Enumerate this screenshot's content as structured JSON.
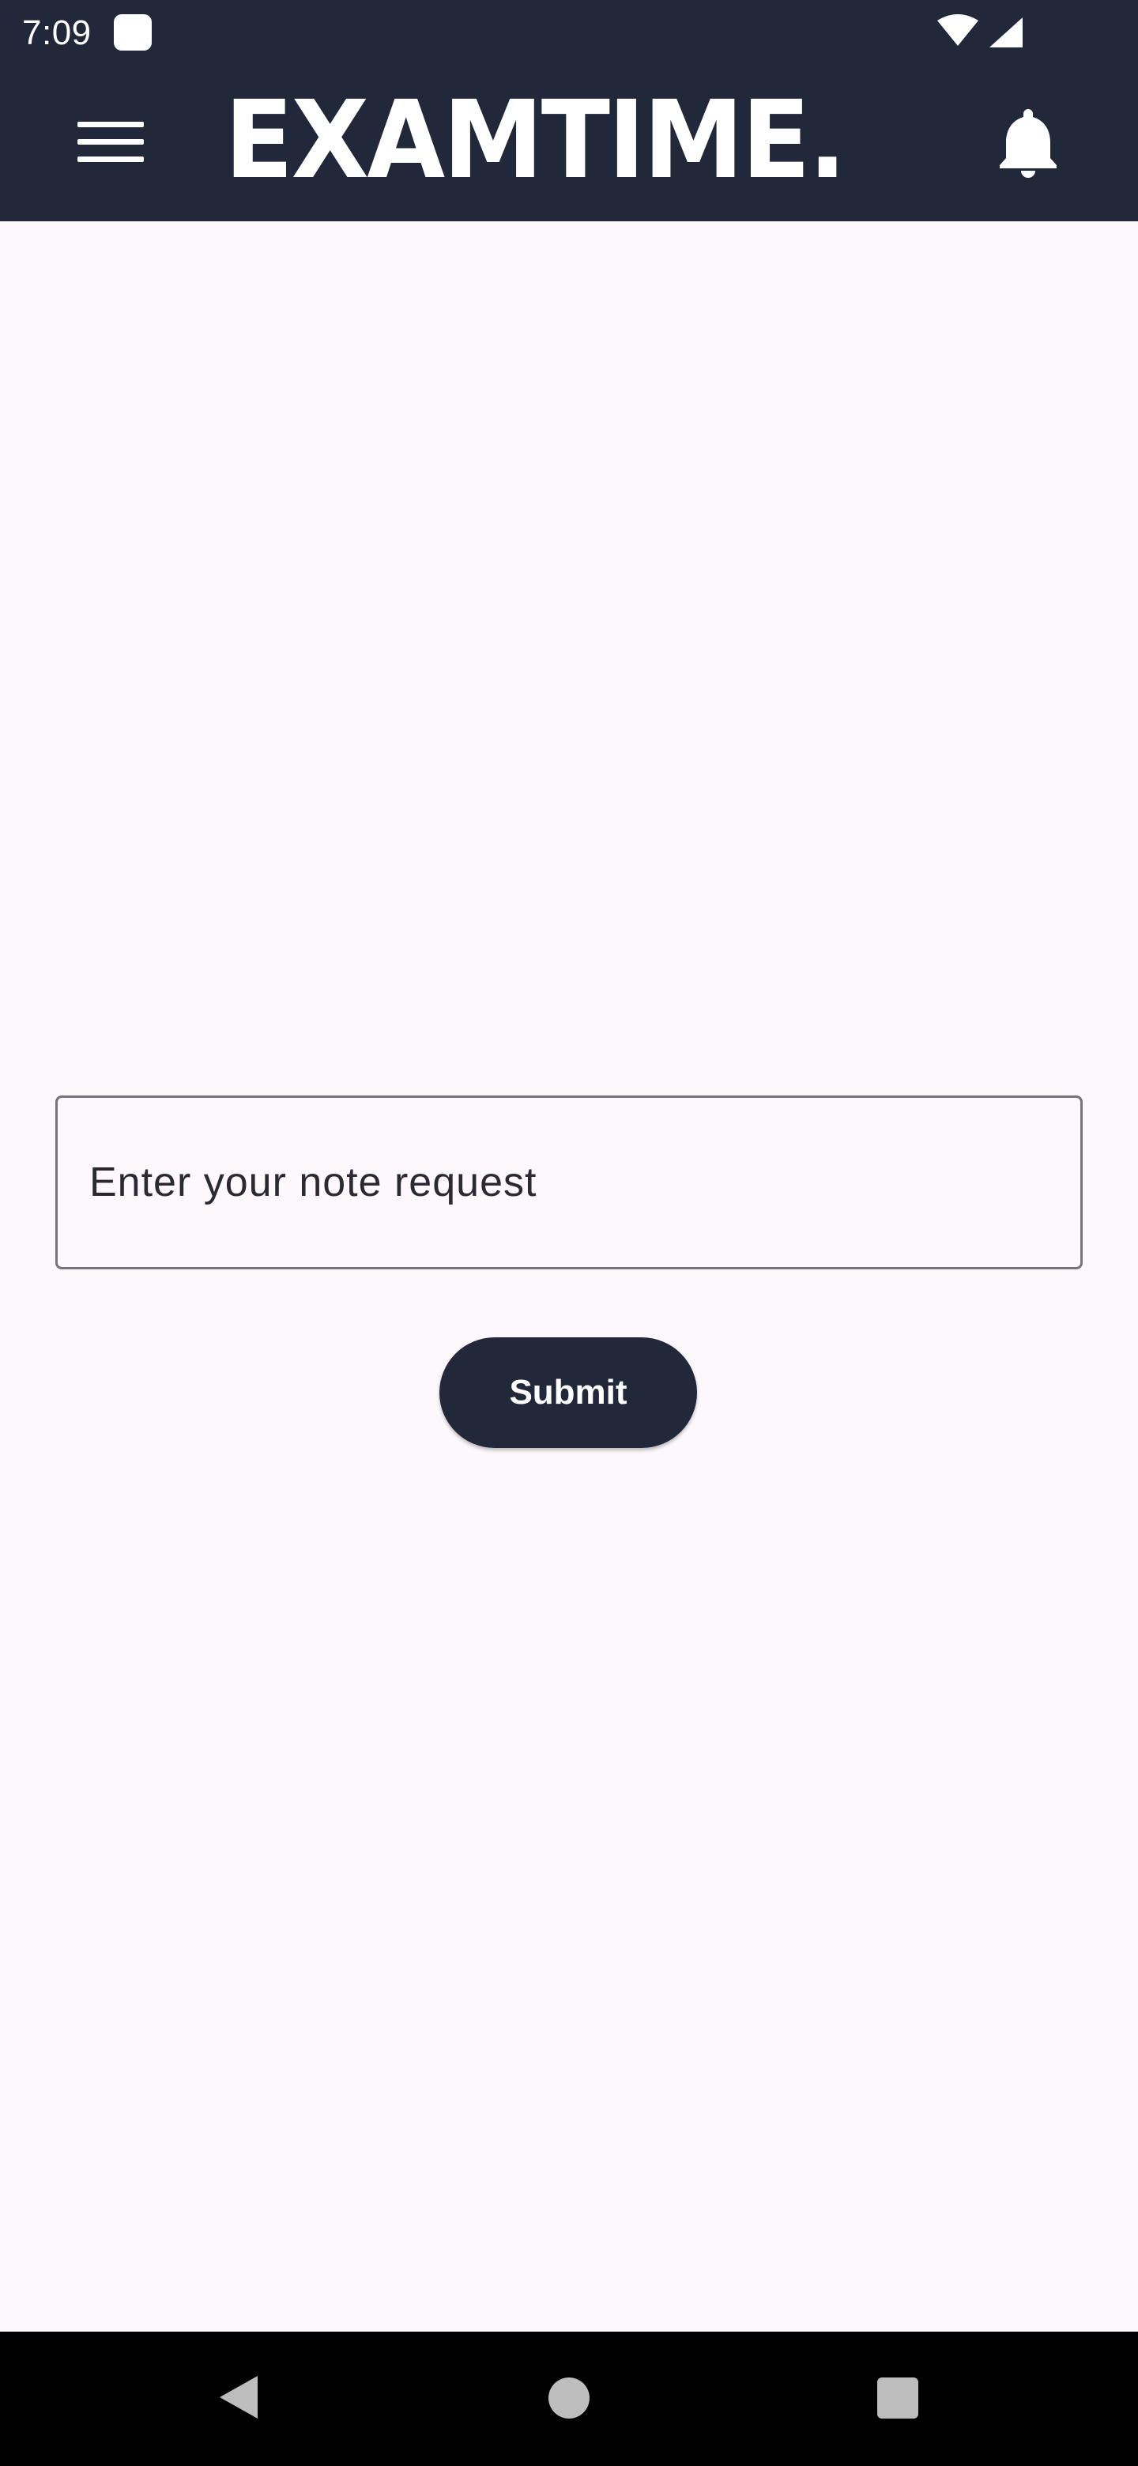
{
  "status_bar": {
    "time": "7:09",
    "notification_icon": "square-app-icon",
    "wifi_icon": "wifi-icon",
    "signal_icon": "cell-signal-icon"
  },
  "app_bar": {
    "menu_icon": "hamburger-menu-icon",
    "logo_text": "EXAMTIME.",
    "notifications_icon": "bell-icon",
    "background_color": "#21283a"
  },
  "note_form": {
    "input_placeholder": "Enter your note request",
    "input_value": "",
    "submit_label": "Submit",
    "button_color": "#21283a"
  },
  "navigation_bar": {
    "back_icon": "back-triangle-icon",
    "home_icon": "home-circle-icon",
    "recents_icon": "recents-square-icon"
  },
  "colors": {
    "page_background": "#fdf8fb",
    "field_border": "#77737a"
  }
}
